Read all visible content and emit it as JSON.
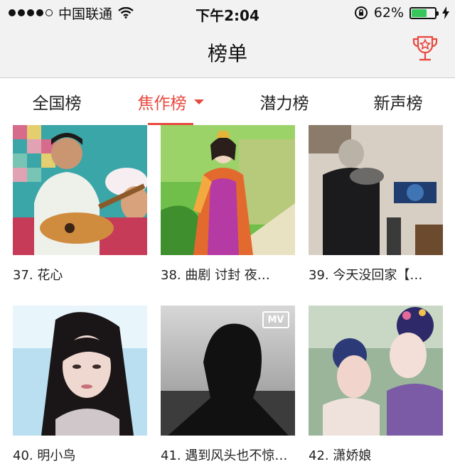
{
  "status_bar": {
    "carrier": "中国联通",
    "time": "下午2:04",
    "battery_percent": "62%",
    "battery_level": 0.62,
    "accent": "#35c759"
  },
  "nav": {
    "title": "榜单",
    "trophy_icon": "trophy-icon",
    "accent": "#e8483e"
  },
  "tabs": [
    {
      "label": "全国榜",
      "active": false
    },
    {
      "label": "焦作榜",
      "active": true
    },
    {
      "label": "潜力榜",
      "active": false
    },
    {
      "label": "新声榜",
      "active": false
    }
  ],
  "songs": [
    {
      "caption": "37. 花心"
    },
    {
      "caption": "38. 曲剧 讨封 夜…"
    },
    {
      "caption": "39. 今天没回家【…"
    },
    {
      "caption": "40. 明小鸟"
    },
    {
      "caption": "41. 遇到风头也不惊…",
      "badge": "MV"
    },
    {
      "caption": "42. 潇娇娘"
    }
  ]
}
